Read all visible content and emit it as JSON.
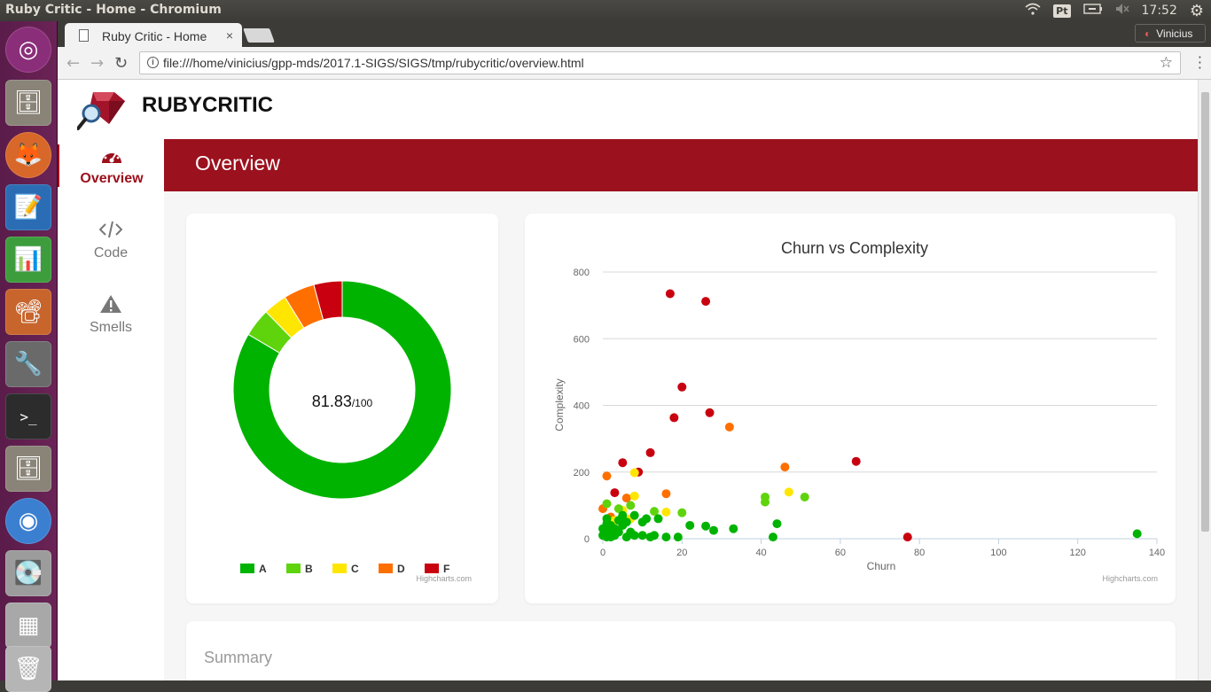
{
  "os": {
    "window_title": "Ruby Critic - Home - Chromium",
    "tray": {
      "keyboard": "Pt",
      "clock": "17:52"
    }
  },
  "browser": {
    "tab_title": "Ruby Critic - Home",
    "tab_close": "×",
    "profile_name": "Vinicius",
    "url": "file:///home/vinicius/gpp-mds/2017.1-SIGS/SIGS/tmp/rubycritic/overview.html"
  },
  "app": {
    "brand": "RUBYCRITIC",
    "nav": [
      {
        "label": "Overview",
        "icon": "dashboard-icon",
        "active": true
      },
      {
        "label": "Code",
        "icon": "code-icon",
        "active": false
      },
      {
        "label": "Smells",
        "icon": "warning-icon",
        "active": false
      }
    ],
    "page_title": "Overview",
    "summary_title": "Summary"
  },
  "colors": {
    "A": "#00b300",
    "B": "#5fd40d",
    "C": "#ffe600",
    "D": "#ff6f00",
    "F": "#c8000f",
    "accent": "#9b111e"
  },
  "chart_data": [
    {
      "type": "pie",
      "variant": "donut",
      "center_label": {
        "score": "81.83",
        "suffix": "/100"
      },
      "slices": [
        {
          "name": "A",
          "value": 83.5,
          "color": "#00b300"
        },
        {
          "name": "B",
          "value": 4.2,
          "color": "#5fd40d"
        },
        {
          "name": "C",
          "value": 3.5,
          "color": "#ffe600"
        },
        {
          "name": "D",
          "value": 4.6,
          "color": "#ff6f00"
        },
        {
          "name": "F",
          "value": 4.2,
          "color": "#c8000f"
        }
      ],
      "legend": [
        "A",
        "B",
        "C",
        "D",
        "F"
      ],
      "legend_placement": "bottom",
      "credit": "Highcharts.com"
    },
    {
      "type": "scatter",
      "title": "Churn vs Complexity",
      "xlabel": "Churn",
      "ylabel": "Complexity",
      "xlim": [
        0,
        140
      ],
      "ylim": [
        0,
        800
      ],
      "xticks": [
        0,
        20,
        40,
        60,
        80,
        100,
        120,
        140
      ],
      "yticks": [
        0,
        200,
        400,
        600,
        800
      ],
      "grid": true,
      "credit": "Highcharts.com",
      "points": [
        [
          17,
          735,
          "F"
        ],
        [
          26,
          712,
          "F"
        ],
        [
          20,
          455,
          "F"
        ],
        [
          27,
          378,
          "F"
        ],
        [
          18,
          363,
          "F"
        ],
        [
          12,
          258,
          "F"
        ],
        [
          5,
          228,
          "F"
        ],
        [
          9,
          200,
          "F"
        ],
        [
          3,
          138,
          "F"
        ],
        [
          64,
          232,
          "F"
        ],
        [
          77,
          5,
          "F"
        ],
        [
          32,
          335,
          "D"
        ],
        [
          46,
          215,
          "D"
        ],
        [
          1,
          188,
          "D"
        ],
        [
          16,
          135,
          "D"
        ],
        [
          6,
          122,
          "D"
        ],
        [
          0,
          90,
          "D"
        ],
        [
          2,
          65,
          "D"
        ],
        [
          8,
          198,
          "C"
        ],
        [
          47,
          140,
          "C"
        ],
        [
          8,
          128,
          "C"
        ],
        [
          3,
          55,
          "C"
        ],
        [
          16,
          80,
          "C"
        ],
        [
          5,
          85,
          "C"
        ],
        [
          7,
          60,
          "C"
        ],
        [
          41,
          125,
          "B"
        ],
        [
          51,
          125,
          "B"
        ],
        [
          41,
          110,
          "B"
        ],
        [
          1,
          105,
          "B"
        ],
        [
          4,
          90,
          "B"
        ],
        [
          7,
          100,
          "B"
        ],
        [
          20,
          78,
          "B"
        ],
        [
          13,
          82,
          "B"
        ],
        [
          135,
          15,
          "A"
        ],
        [
          44,
          45,
          "A"
        ],
        [
          33,
          30,
          "A"
        ],
        [
          28,
          25,
          "A"
        ],
        [
          26,
          38,
          "A"
        ],
        [
          22,
          40,
          "A"
        ],
        [
          19,
          5,
          "A"
        ],
        [
          16,
          5,
          "A"
        ],
        [
          14,
          60,
          "A"
        ],
        [
          13,
          10,
          "A"
        ],
        [
          11,
          60,
          "A"
        ],
        [
          10,
          50,
          "A"
        ],
        [
          10,
          10,
          "A"
        ],
        [
          8,
          70,
          "A"
        ],
        [
          8,
          10,
          "A"
        ],
        [
          7,
          20,
          "A"
        ],
        [
          6,
          5,
          "A"
        ],
        [
          6,
          50,
          "A"
        ],
        [
          5,
          40,
          "A"
        ],
        [
          5,
          70,
          "A"
        ],
        [
          4,
          20,
          "A"
        ],
        [
          4,
          55,
          "A"
        ],
        [
          3,
          10,
          "A"
        ],
        [
          3,
          30,
          "A"
        ],
        [
          2,
          5,
          "A"
        ],
        [
          2,
          40,
          "A"
        ],
        [
          2,
          20,
          "A"
        ],
        [
          1,
          5,
          "A"
        ],
        [
          1,
          25,
          "A"
        ],
        [
          1,
          45,
          "A"
        ],
        [
          1,
          60,
          "A"
        ],
        [
          0,
          10,
          "A"
        ],
        [
          0,
          30,
          "A"
        ],
        [
          43,
          5,
          "A"
        ],
        [
          12,
          5,
          "A"
        ]
      ]
    }
  ]
}
